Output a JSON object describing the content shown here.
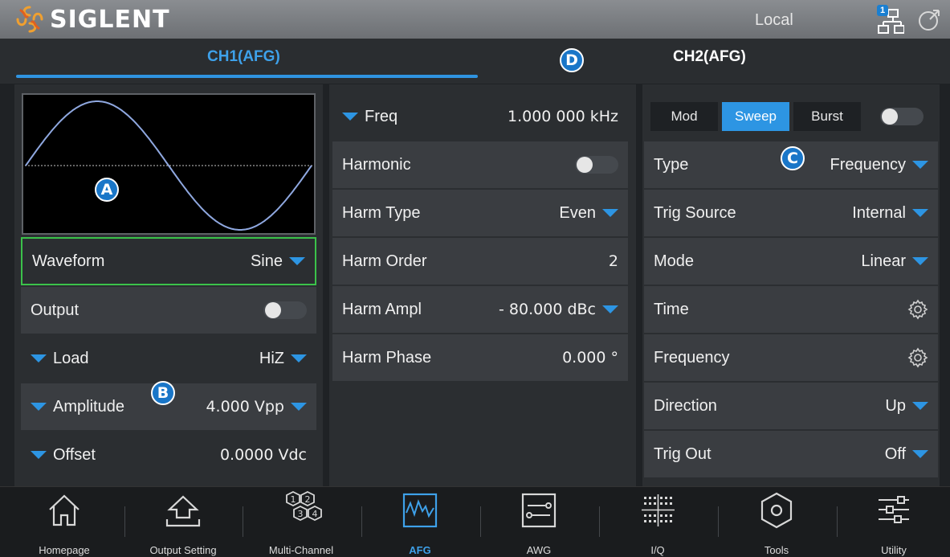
{
  "header": {
    "brand": "SIGLENT",
    "status": "Local",
    "network_badge": "1"
  },
  "tabs": [
    {
      "label": "CH1(AFG)",
      "active": true
    },
    {
      "label": "CH2(AFG)",
      "active": false
    }
  ],
  "markers": {
    "a": "A",
    "b": "B",
    "c": "C",
    "d": "D"
  },
  "left": {
    "waveform": {
      "label": "Waveform",
      "value": "Sine"
    },
    "output": {
      "label": "Output",
      "on": false
    },
    "load": {
      "label": "Load",
      "value": "HiZ"
    },
    "amplitude": {
      "label": "Amplitude",
      "value": "4.000  Vpp"
    },
    "offset": {
      "label": "Offset",
      "value": "0.0000  Vdc"
    }
  },
  "middle": {
    "freq": {
      "label": "Freq",
      "value": "1.000 000  kHz"
    },
    "harmonic": {
      "label": "Harmonic",
      "on": false
    },
    "harm_type": {
      "label": "Harm Type",
      "value": "Even"
    },
    "harm_order": {
      "label": "Harm Order",
      "value": "2"
    },
    "harm_ampl": {
      "label": "Harm Ampl",
      "value": "- 80.000  dBc"
    },
    "harm_phase": {
      "label": "Harm Phase",
      "value": "0.000  °"
    }
  },
  "right": {
    "modes": [
      {
        "label": "Mod",
        "active": false
      },
      {
        "label": "Sweep",
        "active": true
      },
      {
        "label": "Burst",
        "active": false
      }
    ],
    "mode_toggle_on": false,
    "type": {
      "label": "Type",
      "value": "Frequency"
    },
    "trig_source": {
      "label": "Trig Source",
      "value": "Internal"
    },
    "mode": {
      "label": "Mode",
      "value": "Linear"
    },
    "time": {
      "label": "Time",
      "icon": "gear-icon"
    },
    "frequency": {
      "label": "Frequency",
      "icon": "gear-icon"
    },
    "direction": {
      "label": "Direction",
      "value": "Up"
    },
    "trig_out": {
      "label": "Trig Out",
      "value": "Off"
    }
  },
  "nav": [
    {
      "label": "Homepage",
      "icon": "home-icon"
    },
    {
      "label": "Output Setting",
      "icon": "output-setting-icon"
    },
    {
      "label": "Multi-Channel",
      "icon": "multi-channel-icon"
    },
    {
      "label": "AFG",
      "icon": "afg-icon",
      "active": true
    },
    {
      "label": "AWG",
      "icon": "awg-icon"
    },
    {
      "label": "I/Q",
      "icon": "iq-icon"
    },
    {
      "label": "Tools",
      "icon": "tools-icon"
    },
    {
      "label": "Utility",
      "icon": "utility-icon"
    }
  ],
  "colors": {
    "accent": "#2d95e3",
    "selection": "#3bc24a",
    "waveform": "#8fa8e0"
  }
}
